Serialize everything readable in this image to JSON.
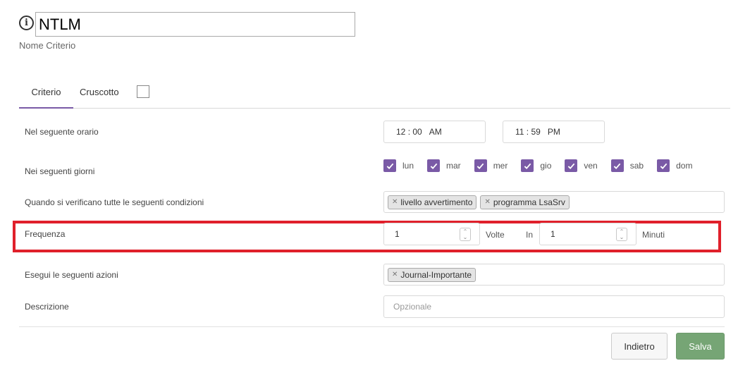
{
  "header": {
    "name_value": "NTLM",
    "name_caption": "Nome Criterio"
  },
  "tabs": [
    {
      "label": "Criterio",
      "active": true
    },
    {
      "label": "Cruscotto",
      "active": false,
      "checked": false
    }
  ],
  "schedule": {
    "label": "Nel seguente orario",
    "start": {
      "hour": "12",
      "minute": "00",
      "period": "AM"
    },
    "end": {
      "hour": "11",
      "minute": "59",
      "period": "PM"
    }
  },
  "days": {
    "label": "Nei seguenti giorni",
    "items": [
      {
        "label": "lun",
        "checked": true
      },
      {
        "label": "mar",
        "checked": true
      },
      {
        "label": "mer",
        "checked": true
      },
      {
        "label": "gio",
        "checked": true
      },
      {
        "label": "ven",
        "checked": true
      },
      {
        "label": "sab",
        "checked": true
      },
      {
        "label": "dom",
        "checked": true
      }
    ]
  },
  "conditions": {
    "label": "Quando si verificano tutte le seguenti condizioni",
    "tags": [
      "livello avvertimento",
      "programma LsaSrv"
    ]
  },
  "frequency": {
    "label": "Frequenza",
    "times_value": "1",
    "times_unit": "Volte",
    "in_label": "In",
    "period_value": "1",
    "period_unit": "Minuti"
  },
  "actions": {
    "label": "Esegui le seguenti azioni",
    "tags": [
      "Journal-Importante"
    ]
  },
  "description": {
    "label": "Descrizione",
    "placeholder": "Opzionale",
    "value": ""
  },
  "buttons": {
    "back_label": "Indietro",
    "save_label": "Salva"
  },
  "colors": {
    "accent": "#7a5aa6",
    "highlight": "#e0202b",
    "save": "#76a575"
  }
}
